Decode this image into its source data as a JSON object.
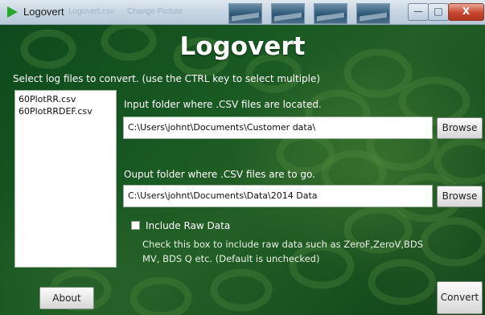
{
  "window": {
    "title": "Logovert",
    "background_tabs": [
      "Logovert.csv",
      "Change Picture"
    ],
    "controls": {
      "minimize": "—",
      "maximize": "□",
      "close": "X"
    }
  },
  "main": {
    "heading": "Logovert",
    "instructions": "Select log files to convert. (use the CTRL key to select multiple)",
    "files": [
      "60PlotRR.csv",
      "60PlotRRDEF.csv"
    ],
    "input_folder": {
      "label": "Input folder where .CSV files are located.",
      "value": "C:\\Users\\johnt\\Documents\\Customer data\\",
      "browse_label": "Browse"
    },
    "output_folder": {
      "label": "Ouput folder where .CSV files are to go.",
      "value": "C:\\Users\\johnt\\Documents\\Data\\2014 Data",
      "browse_label": "Browse"
    },
    "include_raw": {
      "label": "Include Raw Data",
      "checked": false,
      "help": "Check this box to include raw data such as ZeroF,ZeroV,BDS MV, BDS Q etc. (Default is unchecked)"
    },
    "about_label": "About",
    "convert_label": "Convert"
  },
  "colors": {
    "background": "#1a5a23",
    "text": "#ffffff",
    "accent": "#27a829"
  }
}
